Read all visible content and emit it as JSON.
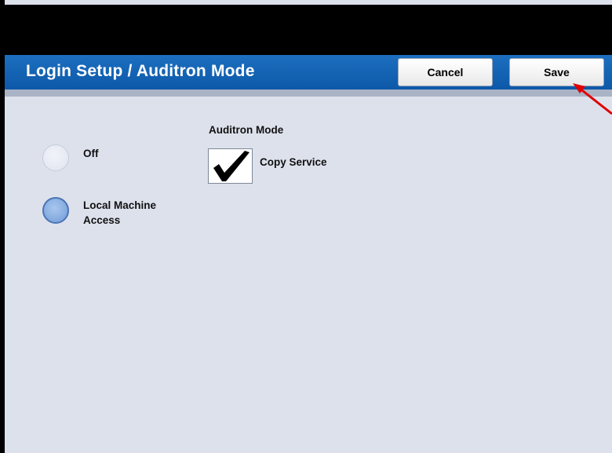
{
  "header": {
    "title": "Login Setup / Auditron Mode",
    "cancel_label": "Cancel",
    "save_label": "Save"
  },
  "login_options": [
    {
      "label": "Off",
      "selected": false
    },
    {
      "label": "Local Machine Access",
      "selected": true
    }
  ],
  "auditron": {
    "section_title": "Auditron Mode",
    "copy_service_label": "Copy Service",
    "copy_service_checked": true
  },
  "colors": {
    "title_bar": "#0d58a8",
    "background": "#dde1ec",
    "selected_radio": "#6f9bd8",
    "annotation_arrow": "#e00000"
  }
}
